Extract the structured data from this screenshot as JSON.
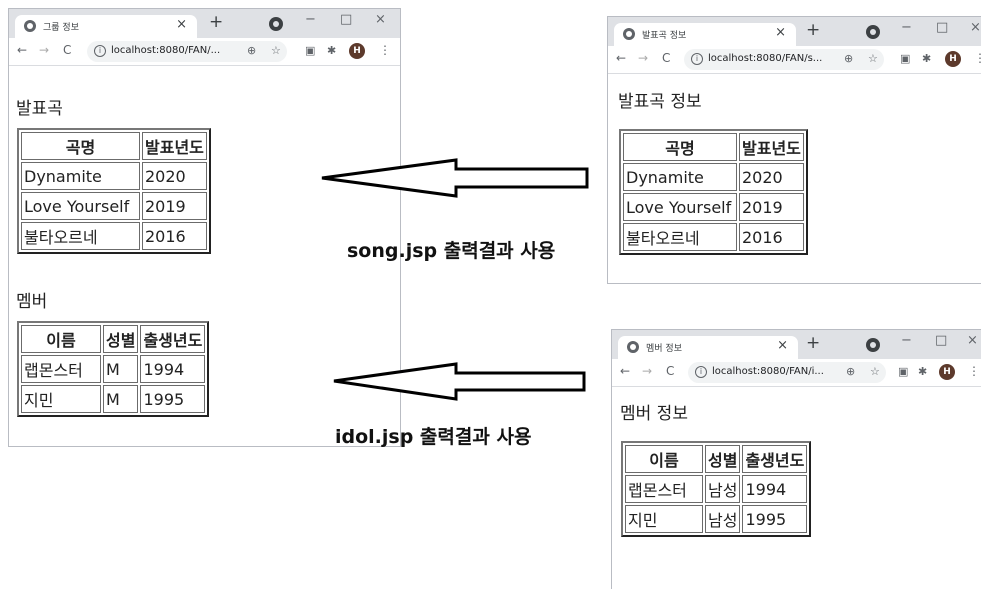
{
  "left_window": {
    "tab_title": "그룹 정보",
    "url": "localhost:8080/FAN/...",
    "avatar_letter": "H",
    "heading_songs": "발표곡",
    "song_table": {
      "headers": [
        "곡명",
        "발표년도"
      ],
      "rows": [
        [
          "Dynamite",
          "2020"
        ],
        [
          "Love Yourself",
          "2019"
        ],
        [
          "불타오르네",
          "2016"
        ]
      ]
    },
    "heading_members": "멤버",
    "member_table": {
      "headers": [
        "이름",
        "성별",
        "출생년도"
      ],
      "rows": [
        [
          "랩몬스터",
          "M",
          "1994"
        ],
        [
          "지민",
          "M",
          "1995"
        ]
      ]
    }
  },
  "top_right_window": {
    "tab_title": "발표곡 정보",
    "url": "localhost:8080/FAN/s...",
    "avatar_letter": "H",
    "heading": "발표곡 정보",
    "table": {
      "headers": [
        "곡명",
        "발표년도"
      ],
      "rows": [
        [
          "Dynamite",
          "2020"
        ],
        [
          "Love Yourself",
          "2019"
        ],
        [
          "불타오르네",
          "2016"
        ]
      ]
    }
  },
  "bottom_right_window": {
    "tab_title": "멤버 정보",
    "url": "localhost:8080/FAN/i...",
    "avatar_letter": "H",
    "heading": "멤버 정보",
    "table": {
      "headers": [
        "이름",
        "성별",
        "출생년도"
      ],
      "rows": [
        [
          "랩몬스터",
          "남성",
          "1994"
        ],
        [
          "지민",
          "남성",
          "1995"
        ]
      ]
    }
  },
  "annotations": {
    "song_caption": "song.jsp 출력결과 사용",
    "idol_caption": "idol.jsp 출력결과 사용"
  },
  "icons": {
    "back": "←",
    "forward": "→",
    "reload": "C",
    "info": "i",
    "zoom": "⊕",
    "star": "☆",
    "close": "×",
    "newtab": "+",
    "minimize": "−",
    "maximize": "□",
    "window_close": "×",
    "menu": "⋮"
  }
}
